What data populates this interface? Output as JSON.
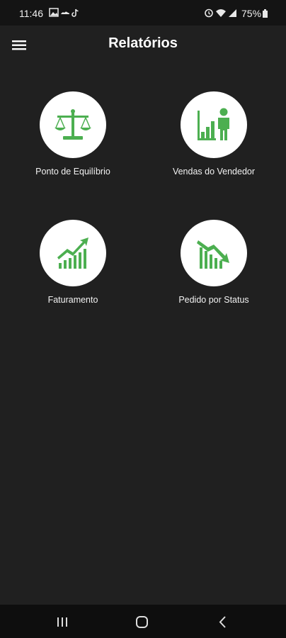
{
  "status_bar": {
    "time": "11:46",
    "battery": "75%",
    "left_icons": [
      "image-icon",
      "weather-icon",
      "tiktok-icon"
    ],
    "right_icons": [
      "alarm-icon",
      "wifi-icon",
      "signal-icon",
      "battery-icon"
    ]
  },
  "header": {
    "title": "Relatórios",
    "menu_icon": "menu-icon"
  },
  "reports": [
    {
      "label": "Ponto de Equilíbrio",
      "icon": "balance-scale-icon"
    },
    {
      "label": "Vendas do Vendedor",
      "icon": "seller-chart-icon"
    },
    {
      "label": "Faturamento",
      "icon": "trend-up-icon"
    },
    {
      "label": "Pedido por Status",
      "icon": "trend-down-icon"
    }
  ],
  "navigation": {
    "buttons": [
      "recent-apps-icon",
      "home-icon",
      "back-icon"
    ]
  },
  "colors": {
    "background": "#202020",
    "accent": "#4caf50",
    "circle": "#ffffff",
    "text": "#ffffff"
  }
}
